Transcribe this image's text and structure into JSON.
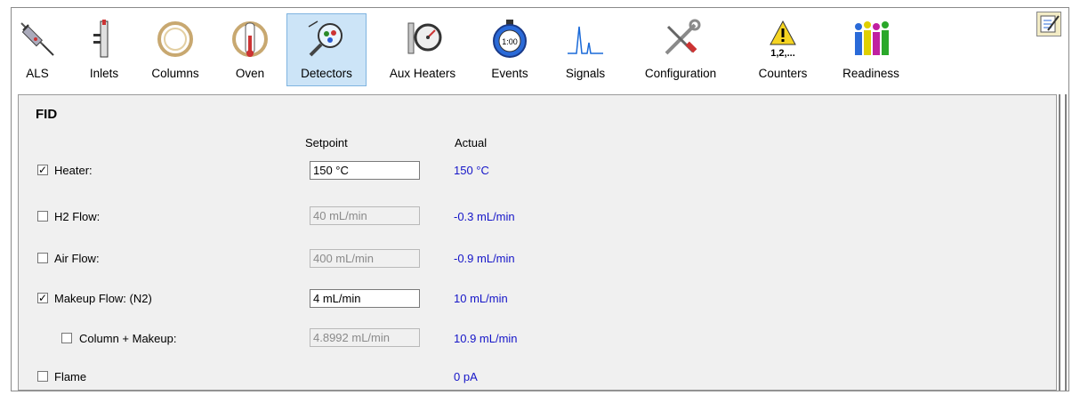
{
  "toolbar": {
    "items": [
      {
        "label": "ALS",
        "icon": "syringe-icon"
      },
      {
        "label": "Inlets",
        "icon": "inlet-icon"
      },
      {
        "label": "Columns",
        "icon": "column-coil-icon"
      },
      {
        "label": "Oven",
        "icon": "oven-icon"
      },
      {
        "label": "Detectors",
        "icon": "detector-magnifier-icon",
        "active": true
      },
      {
        "label": "Aux Heaters",
        "icon": "gauge-icon"
      },
      {
        "label": "Events",
        "icon": "stopwatch-icon"
      },
      {
        "label": "Signals",
        "icon": "signal-peak-icon"
      },
      {
        "label": "Configuration",
        "icon": "tools-icon"
      },
      {
        "label": "Counters",
        "icon": "warning-counter-icon",
        "icon_text": "1,2,..."
      },
      {
        "label": "Readiness",
        "icon": "people-icon"
      }
    ],
    "notes_icon": "notepad-check-icon"
  },
  "detector": {
    "title": "FID",
    "setpoint_header": "Setpoint",
    "actual_header": "Actual",
    "rows": [
      {
        "label": "Heater:",
        "checked": true,
        "setpoint": "150 °C",
        "enabled": true,
        "actual": "150 °C"
      },
      {
        "label": "H2 Flow:",
        "checked": false,
        "setpoint": "40 mL/min",
        "enabled": false,
        "actual": "-0.3 mL/min"
      },
      {
        "label": "Air Flow:",
        "checked": false,
        "setpoint": "400 mL/min",
        "enabled": false,
        "actual": "-0.9 mL/min"
      },
      {
        "label": "Makeup Flow: (N2)",
        "checked": true,
        "setpoint": "4 mL/min",
        "enabled": true,
        "actual": "10 mL/min"
      },
      {
        "label": "Column + Makeup:",
        "checked": false,
        "setpoint": "4.8992 mL/min",
        "enabled": false,
        "actual": "10.9 mL/min"
      },
      {
        "label": "Flame",
        "checked": false,
        "setpoint": "",
        "enabled": false,
        "actual": "0 pA"
      }
    ]
  },
  "colors": {
    "actual_text": "#1515c8",
    "active_tab": "#cce4f7"
  }
}
